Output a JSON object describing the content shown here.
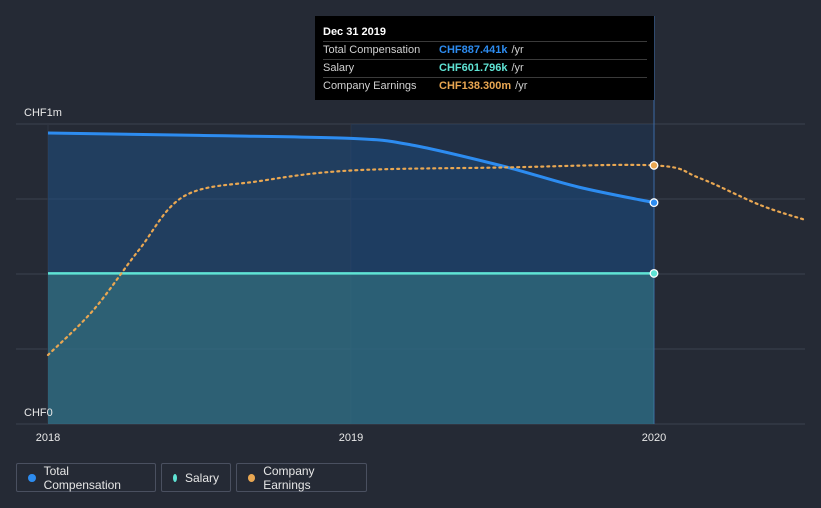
{
  "chart_data": {
    "type": "line",
    "y_axis": {
      "top_label": "CHF1m",
      "bottom_label": "CHF0",
      "ylim": [
        0,
        1000000
      ]
    },
    "x_axis": {
      "ticks": [
        {
          "label": "2018",
          "x": 2018.0
        },
        {
          "label": "2019",
          "x": 2019.0
        },
        {
          "label": "2020",
          "x": 2020.0
        }
      ],
      "xlim": [
        2018.0,
        2020.5
      ]
    },
    "grid": true,
    "series": [
      {
        "key": "total",
        "name": "Total Compensation",
        "color": "#2d8cf0",
        "style": "solid-area",
        "points": [
          [
            2018.0,
            970000
          ],
          [
            2018.5,
            962000
          ],
          [
            2019.0,
            952000
          ],
          [
            2019.2,
            930000
          ],
          [
            2019.5,
            860000
          ],
          [
            2019.75,
            790000
          ],
          [
            2020.0,
            738000
          ]
        ]
      },
      {
        "key": "salary",
        "name": "Salary",
        "color": "#5fe3d4",
        "style": "solid-area",
        "points": [
          [
            2018.0,
            502000
          ],
          [
            2020.0,
            502000
          ]
        ]
      },
      {
        "key": "earnings",
        "name": "Company Earnings",
        "color": "#e9a752",
        "style": "dotted",
        "points": [
          [
            2018.0,
            230000
          ],
          [
            2018.15,
            380000
          ],
          [
            2018.3,
            580000
          ],
          [
            2018.45,
            760000
          ],
          [
            2018.7,
            810000
          ],
          [
            2019.0,
            845000
          ],
          [
            2019.5,
            855000
          ],
          [
            2020.0,
            862000
          ],
          [
            2020.15,
            820000
          ],
          [
            2020.35,
            730000
          ],
          [
            2020.5,
            680000
          ]
        ]
      }
    ],
    "highlight_x": 2020.0
  },
  "tooltip": {
    "date": "Dec 31 2019",
    "rows": [
      {
        "label": "Total Compensation",
        "value": "CHF887.441k",
        "unit": "/yr",
        "color": "#2d8cf0"
      },
      {
        "label": "Salary",
        "value": "CHF601.796k",
        "unit": "/yr",
        "color": "#5fe3d4"
      },
      {
        "label": "Company Earnings",
        "value": "CHF138.300m",
        "unit": "/yr",
        "color": "#e9a752"
      }
    ]
  },
  "legend": {
    "items": [
      {
        "label": "Total Compensation",
        "color": "#2d8cf0"
      },
      {
        "label": "Salary",
        "color": "#5fe3d4"
      },
      {
        "label": "Company Earnings",
        "color": "#e9a752"
      }
    ]
  }
}
